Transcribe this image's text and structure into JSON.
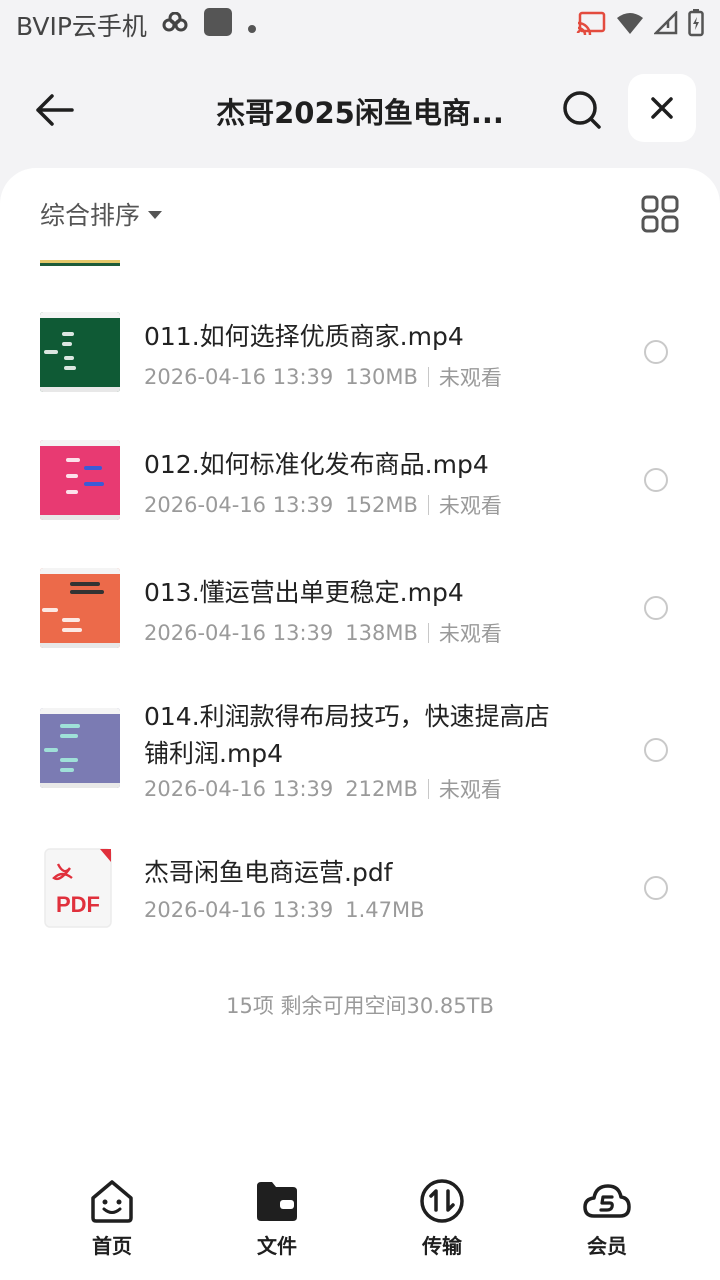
{
  "status_bar": {
    "carrier": "BVIP云手机"
  },
  "header": {
    "title": "杰哥2025闲鱼电商..."
  },
  "toolbar": {
    "sort_label": "综合排序"
  },
  "files": [
    {
      "name": "011.如何选择优质商家.mp4",
      "date": "2026-04-16 13:39",
      "size": "130MB",
      "status": "未观看",
      "thumb_color": "#0f5a35"
    },
    {
      "name": "012.如何标准化发布商品.mp4",
      "date": "2026-04-16 13:39",
      "size": "152MB",
      "status": "未观看",
      "thumb_color": "#e83a72"
    },
    {
      "name": "013.懂运营出单更稳定.mp4",
      "date": "2026-04-16 13:39",
      "size": "138MB",
      "status": "未观看",
      "thumb_color": "#ec6a4a"
    },
    {
      "name": "014.利润款得布局技巧，快速提高店铺利润.mp4",
      "date": "2026-04-16 13:39",
      "size": "212MB",
      "status": "未观看",
      "thumb_color": "#7b7bb3"
    },
    {
      "name": "杰哥闲鱼电商运营.pdf",
      "date": "2026-04-16 13:39",
      "size": "1.47MB",
      "icon": "pdf-icon",
      "icon_label": "PDF"
    }
  ],
  "summary": "15项 剩余可用空间30.85TB",
  "bottom_nav": [
    {
      "label": "首页",
      "icon": "home-face-icon"
    },
    {
      "label": "文件",
      "icon": "folder-icon"
    },
    {
      "label": "传输",
      "icon": "transfer-icon"
    },
    {
      "label": "会员",
      "icon": "vip-cloud-icon"
    }
  ]
}
